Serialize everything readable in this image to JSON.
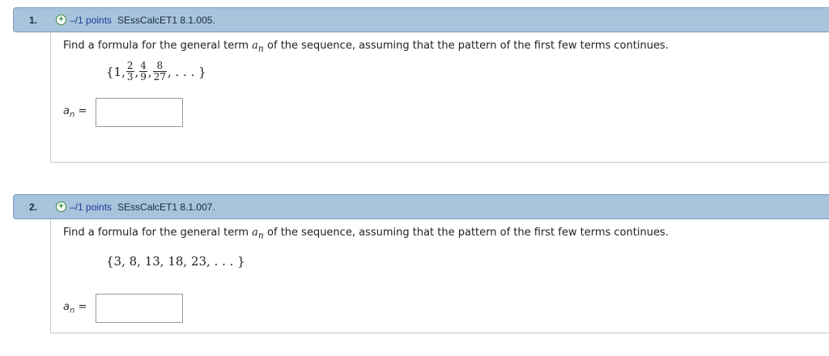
{
  "questions": [
    {
      "number": "1.",
      "points": "–/1 points",
      "code": "SEssCalcET1 8.1.005.",
      "prompt_before": "Find a formula for the general term ",
      "term_var": "a",
      "term_sub": "n",
      "prompt_after": " of the sequence, assuming that the pattern of the first few terms continues.",
      "sequence": {
        "open": "{1,",
        "fractions": [
          {
            "num": "2",
            "den": "3"
          },
          {
            "num": "4",
            "den": "9"
          },
          {
            "num": "8",
            "den": "27"
          }
        ],
        "close": ", . . . }"
      },
      "answer_label": "a",
      "answer_sub": "n",
      "answer_eq": "=",
      "answer_value": ""
    },
    {
      "number": "2.",
      "points": "–/1 points",
      "code": "SEssCalcET1 8.1.007.",
      "prompt_before": "Find a formula for the general term ",
      "term_var": "a",
      "term_sub": "n",
      "prompt_after": " of the sequence, assuming that the pattern of the first few terms continues.",
      "sequence_text": "{3, 8, 13, 18, 23, . . . }",
      "answer_label": "a",
      "answer_sub": "n",
      "answer_eq": "=",
      "answer_value": ""
    }
  ],
  "icons": {
    "expand": "plus-circle-icon"
  },
  "colors": {
    "header_bg": "#a7c4dc",
    "points_text": "#1e3a9a",
    "plus_icon": "#2e8b2e"
  }
}
